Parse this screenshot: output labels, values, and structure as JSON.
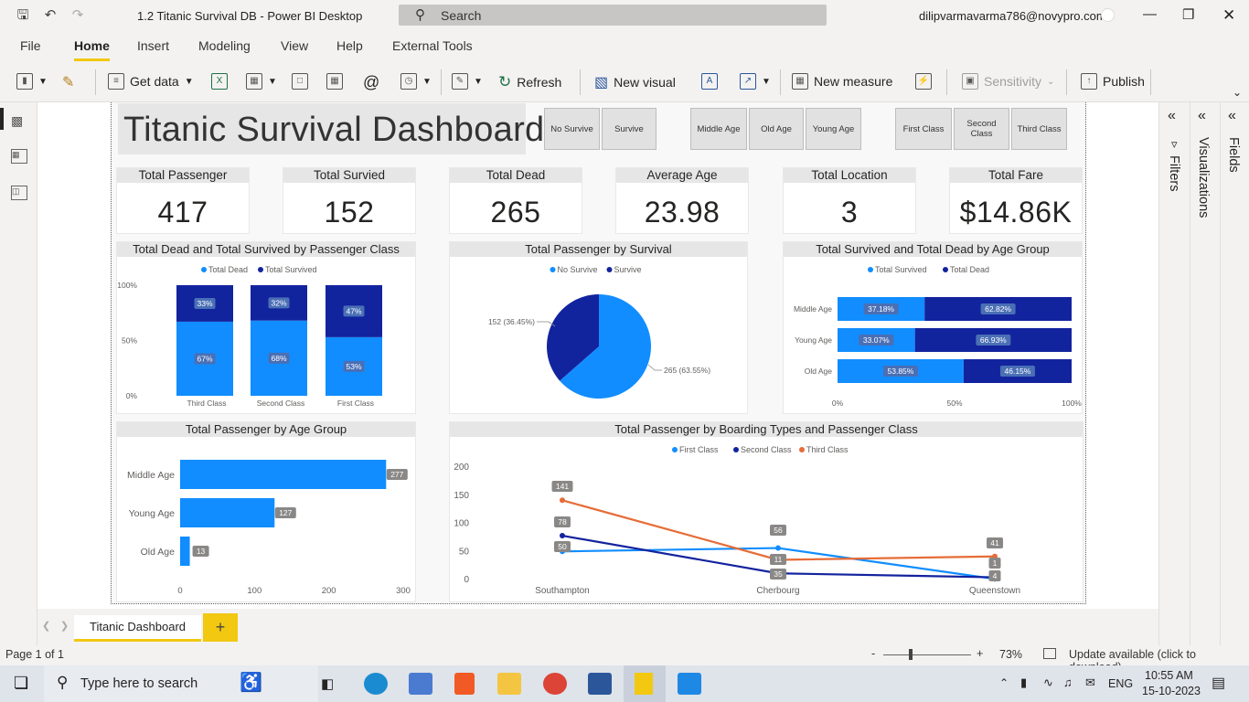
{
  "app": {
    "title": "1.2 Titanic Survival DB - Power BI Desktop",
    "search_placeholder": "Search",
    "user": "dilipvarmavarma786@novypro.com"
  },
  "menu": [
    "File",
    "Home",
    "Insert",
    "Modeling",
    "View",
    "Help",
    "External Tools"
  ],
  "ribbon": {
    "get_data": "Get data",
    "refresh": "Refresh",
    "new_visual": "New visual",
    "new_measure": "New measure",
    "sensitivity": "Sensitivity",
    "publish": "Publish"
  },
  "dashboard": {
    "title": "Titanic Survival Dashboard",
    "slicers": {
      "survival": [
        "No Survive",
        "Survive"
      ],
      "age": [
        "Middle Age",
        "Old Age",
        "Young Age"
      ],
      "class": [
        "First Class",
        "Second Class",
        "Third Class"
      ]
    },
    "cards": [
      {
        "label": "Total Passenger",
        "value": "417"
      },
      {
        "label": "Total Survied",
        "value": "152"
      },
      {
        "label": "Total Dead",
        "value": "265"
      },
      {
        "label": "Average Age",
        "value": "23.98"
      },
      {
        "label": "Total Location",
        "value": "3"
      },
      {
        "label": "Total Fare",
        "value": "$14.86K"
      }
    ]
  },
  "chart_data": [
    {
      "type": "bar",
      "title": "Total Dead and Total Survived by Passenger Class",
      "stacked": "100%",
      "categories": [
        "Third Class",
        "Second Class",
        "First Class"
      ],
      "series": [
        {
          "name": "Total Dead",
          "values": [
            67,
            68,
            53
          ],
          "labels": [
            "67%",
            "68%",
            "53%"
          ]
        },
        {
          "name": "Total Survived",
          "values": [
            33,
            32,
            47
          ],
          "labels": [
            "33%",
            "32%",
            "47%"
          ]
        }
      ],
      "y_ticks": [
        "0%",
        "50%",
        "100%"
      ]
    },
    {
      "type": "pie",
      "title": "Total Passenger by Survival",
      "series": [
        {
          "name": "No Survive",
          "value": 265,
          "label": "265 (63.55%)"
        },
        {
          "name": "Survive",
          "value": 152,
          "label": "152 (36.45%)"
        }
      ]
    },
    {
      "type": "bar",
      "orientation": "horizontal",
      "stacked": "100%",
      "title": "Total Survived and Total Dead by Age Group",
      "categories": [
        "Middle Age",
        "Young Age",
        "Old Age"
      ],
      "series": [
        {
          "name": "Total Survived",
          "values": [
            37.18,
            33.07,
            53.85
          ],
          "labels": [
            "37.18%",
            "33.07%",
            "53.85%"
          ]
        },
        {
          "name": "Total Dead",
          "values": [
            62.82,
            66.93,
            46.15
          ],
          "labels": [
            "62.82%",
            "66.93%",
            "46.15%"
          ]
        }
      ],
      "x_ticks": [
        "0%",
        "50%",
        "100%"
      ]
    },
    {
      "type": "bar",
      "orientation": "horizontal",
      "title": "Total Passenger by Age Group",
      "categories": [
        "Middle Age",
        "Young Age",
        "Old Age"
      ],
      "values": [
        277,
        127,
        13
      ],
      "xlim": [
        0,
        300
      ],
      "x_ticks": [
        "0",
        "100",
        "200",
        "300"
      ]
    },
    {
      "type": "line",
      "title": "Total Passenger by Boarding Types and Passenger Class",
      "categories": [
        "Southampton",
        "Cherbourg",
        "Queenstown"
      ],
      "series": [
        {
          "name": "First Class",
          "values": [
            50,
            56,
            1
          ]
        },
        {
          "name": "Second Class",
          "values": [
            78,
            11,
            4
          ]
        },
        {
          "name": "Third Class",
          "values": [
            141,
            35,
            41
          ]
        }
      ],
      "ylim": [
        0,
        200
      ],
      "y_ticks": [
        "0",
        "50",
        "100",
        "150",
        "200"
      ]
    }
  ],
  "colors": {
    "light_blue": "#118dff",
    "dark_blue": "#12239e",
    "orange": "#e66c37",
    "yellow": "#f2c811"
  },
  "right_pane": {
    "filters": "Filters",
    "visualizations": "Visualizations",
    "fields": "Fields"
  },
  "page_tab": "Titanic Dashboard",
  "status": {
    "page": "Page 1 of 1",
    "zoom": "73%",
    "update": "Update available (click to download)"
  },
  "taskbar": {
    "search_placeholder": "Type here to search",
    "lang": "ENG",
    "time": "10:55 AM",
    "date": "15-10-2023"
  }
}
